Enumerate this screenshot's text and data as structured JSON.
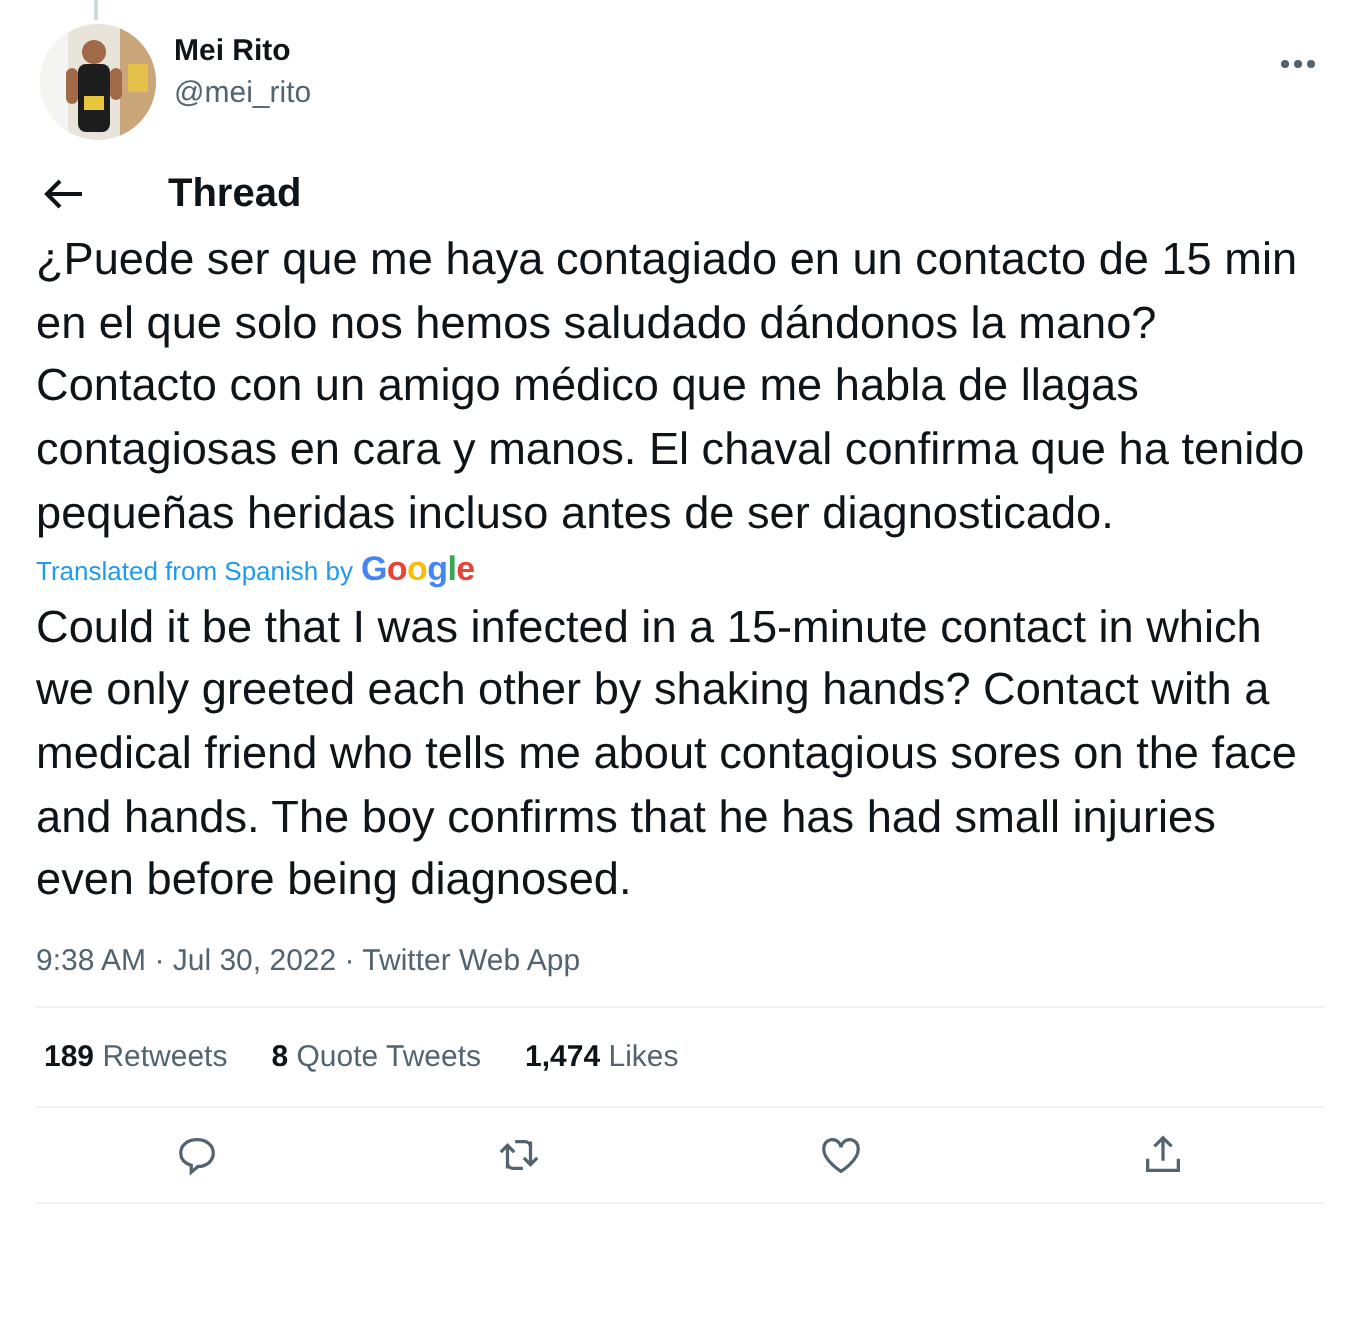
{
  "author": {
    "name": "Mei Rito",
    "handle": "@mei_rito"
  },
  "header": {
    "title": "Thread"
  },
  "tweet": {
    "original_text": "¿Puede ser que me haya contagiado en un contacto de 15 min en el que solo nos hemos saludado dándonos la mano? Contacto con un amigo médico que me habla de llagas contagiosas en cara y manos. El chaval confirma que ha tenido pequeñas heridas incluso antes de ser diagnosticado.",
    "translation_note": "Translated from Spanish by",
    "translation_brand": "Google",
    "translated_text": "Could it be that I was infected in a 15-minute contact in which we only greeted each other by shaking hands? Contact with a medical friend who tells me about contagious sores on the face and hands. The boy confirms that he has had small injuries even before being diagnosed.",
    "meta": "9:38 AM · Jul 30, 2022 · Twitter Web App"
  },
  "stats": [
    {
      "count": "189",
      "label": "Retweets"
    },
    {
      "count": "8",
      "label": "Quote Tweets"
    },
    {
      "count": "1,474",
      "label": "Likes"
    }
  ],
  "actions": [
    {
      "kind": "reply"
    },
    {
      "kind": "retweet"
    },
    {
      "kind": "like"
    },
    {
      "kind": "share"
    }
  ]
}
